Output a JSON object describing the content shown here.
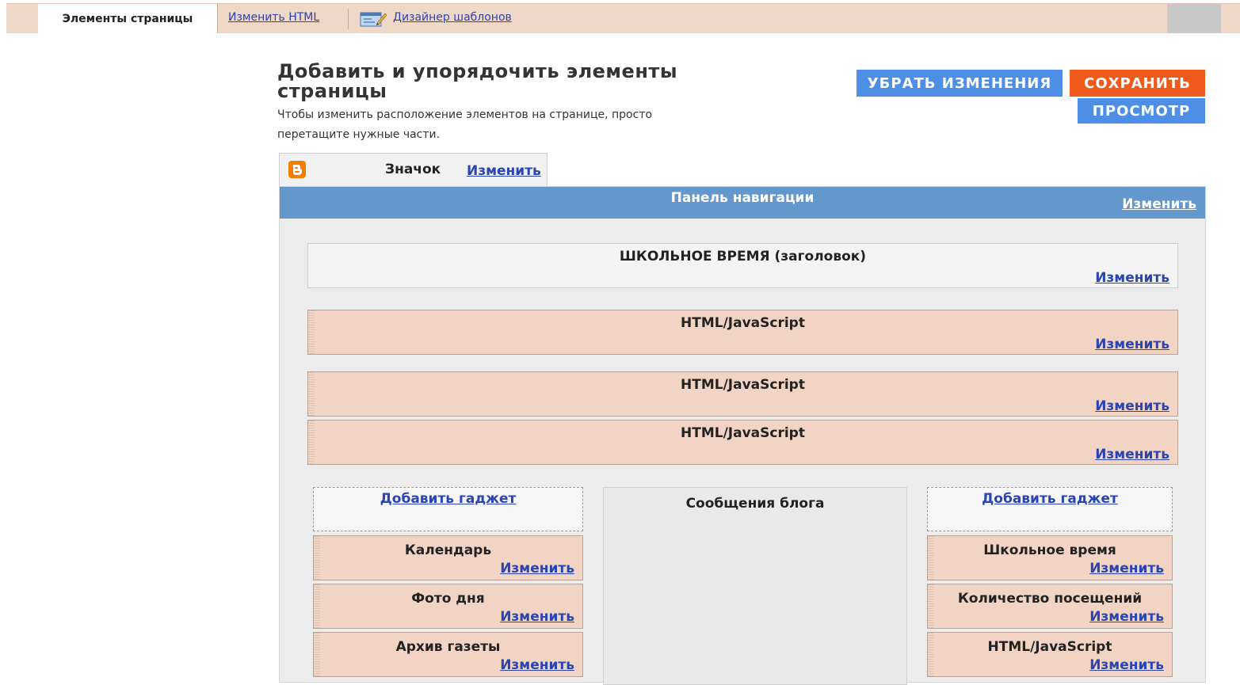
{
  "tabs": {
    "active": "Элементы страницы",
    "edit_html": "Изменить HTML",
    "template_designer": "Дизайнер шаблонов"
  },
  "header": {
    "title": "Добавить и упорядочить элементы страницы",
    "description": "Чтобы изменить расположение элементов на странице, просто перетащите нужные части."
  },
  "buttons": {
    "revert": "УБРАТЬ ИЗМЕНЕНИЯ",
    "save": "СОХРАНИТЬ",
    "preview": "ПРОСМОТР"
  },
  "favicon": {
    "label": "Значок",
    "edit": "Изменить"
  },
  "navbar": {
    "title": "Панель навигации",
    "edit": "Изменить"
  },
  "edit_label": "Изменить",
  "header_widget": {
    "title": "ШКОЛЬНОЕ ВРЕМЯ (заголовок)"
  },
  "main_widgets": [
    {
      "title": "HTML/JavaScript"
    },
    {
      "title": "HTML/JavaScript"
    },
    {
      "title": "HTML/JavaScript"
    }
  ],
  "add_gadget": "Добавить гаджет",
  "blog_posts": {
    "title": "Сообщения блога"
  },
  "left_sidebar": [
    {
      "title": "Календарь"
    },
    {
      "title": "Фото дня"
    },
    {
      "title": "Архив газеты"
    }
  ],
  "right_sidebar": [
    {
      "title": "Школьное время"
    },
    {
      "title": "Количество посещений"
    },
    {
      "title": "HTML/JavaScript"
    }
  ],
  "colors": {
    "accent_blue": "#4d8ee6",
    "save_orange": "#f15a1d",
    "navbar_blue": "#6497cc",
    "widget_peach": "#f2d4c4",
    "link_blue": "#2a44b4"
  }
}
